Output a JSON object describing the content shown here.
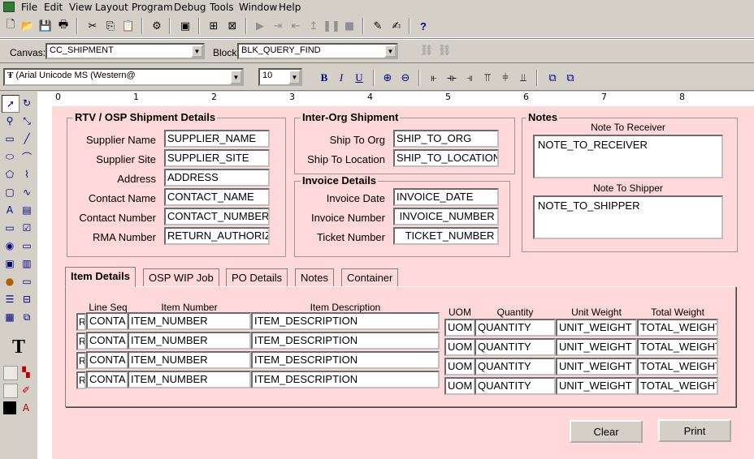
{
  "menu": [
    "File",
    "Edit",
    "View",
    "Layout",
    "Program",
    "Debug",
    "Tools",
    "Window",
    "Help"
  ],
  "toolbar2": {
    "canvas_label": "Canvas:",
    "canvas_value": "CC_SHIPMENT",
    "block_label": "Block:",
    "block_value": "BLK_QUERY_FIND"
  },
  "toolbar3": {
    "font_value": "(Arial Unicode MS (Western@",
    "size_value": "10",
    "bold": "B",
    "italic": "I",
    "underline": "U"
  },
  "ruler_ticks": [
    "0",
    "1",
    "2",
    "3",
    "4",
    "5",
    "6",
    "7",
    "8"
  ],
  "rtv": {
    "title": "RTV / OSP Shipment Details",
    "rows": [
      {
        "label": "Supplier Name",
        "value": "SUPPLIER_NAME"
      },
      {
        "label": "Supplier Site",
        "value": "SUPPLIER_SITE"
      },
      {
        "label": "Address",
        "value": "ADDRESS"
      },
      {
        "label": "Contact Name",
        "value": "CONTACT_NAME"
      },
      {
        "label": "Contact Number",
        "value": "CONTACT_NUMBER"
      },
      {
        "label": "RMA Number",
        "value": "RETURN_AUTHORIZ"
      }
    ]
  },
  "interorg": {
    "title": "Inter-Org Shipment",
    "rows": [
      {
        "label": "Ship To Org",
        "value": "SHIP_TO_ORG"
      },
      {
        "label": "Ship To Location",
        "value": "SHIP_TO_LOCATION"
      }
    ]
  },
  "invoice": {
    "title": "Invoice Details",
    "rows": [
      {
        "label": "Invoice Date",
        "value": "INVOICE_DATE"
      },
      {
        "label": "Invoice Number",
        "value": " INVOICE_NUMBER"
      },
      {
        "label": "Ticket Number",
        "value": "   TICKET_NUMBER"
      }
    ]
  },
  "notes": {
    "title": "Notes",
    "receiver_label": "Note To Receiver",
    "receiver_value": "NOTE_TO_RECEIVER",
    "shipper_label": "Note To Shipper",
    "shipper_value": "NOTE_TO_SHIPPER"
  },
  "tabs": [
    "Item Details",
    "OSP WIP Job",
    "PO Details",
    "Notes",
    "Container"
  ],
  "items": {
    "headers": {
      "line_seq": "Line Seq",
      "item_number": "Item Number",
      "item_description": "Item Description",
      "uom": "UOM",
      "quantity": "Quantity",
      "unit_weight": "Unit Weight",
      "total_weight": "Total Weight"
    },
    "rows": [
      {
        "flag": "R",
        "line": "CONTA",
        "item": "ITEM_NUMBER",
        "desc": "ITEM_DESCRIPTION",
        "uom": "UOM",
        "qty": "QUANTITY",
        "uw": "UNIT_WEIGHT",
        "tw": "TOTAL_WEIGHT"
      },
      {
        "flag": "R",
        "line": "CONTA",
        "item": "ITEM_NUMBER",
        "desc": "ITEM_DESCRIPTION",
        "uom": "UOM",
        "qty": "QUANTITY",
        "uw": "UNIT_WEIGHT",
        "tw": "TOTAL_WEIGHT"
      },
      {
        "flag": "R",
        "line": "CONTA",
        "item": "ITEM_NUMBER",
        "desc": "ITEM_DESCRIPTION",
        "uom": "UOM",
        "qty": "QUANTITY",
        "uw": "UNIT_WEIGHT",
        "tw": "TOTAL_WEIGHT"
      },
      {
        "flag": "R",
        "line": "CONTA",
        "item": "ITEM_NUMBER",
        "desc": "ITEM_DESCRIPTION",
        "uom": "UOM",
        "qty": "QUANTITY",
        "uw": "UNIT_WEIGHT",
        "tw": "TOTAL_WEIGHT"
      }
    ]
  },
  "buttons": {
    "clear": "Clear",
    "print": "Print"
  },
  "palette_text_tool": "T"
}
